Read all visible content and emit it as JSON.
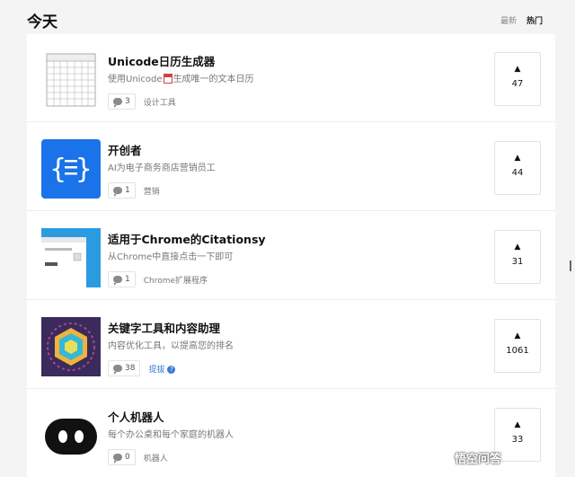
{
  "header": {
    "title": "今天",
    "tabs": [
      {
        "label": "最新",
        "active": false
      },
      {
        "label": "热门",
        "active": true
      }
    ]
  },
  "items": [
    {
      "name": "Unicode日历生成器",
      "desc": "使用Unicode",
      "desc_suffix": "生成唯一的文本日历",
      "comments": "3",
      "tag": "设计工具",
      "votes": "47",
      "thumb_icon": "calendar-grid-icon"
    },
    {
      "name": "开创者",
      "desc": "AI为电子商务商店营销员工",
      "comments": "1",
      "tag": "营销",
      "votes": "44",
      "thumb_icon": "braces-chat-icon",
      "thumb_color": "#1a73e8"
    },
    {
      "name": "适用于Chrome的Citationsy",
      "desc": "从Chrome中直接点击一下即可",
      "comments": "1",
      "tag": "Chrome扩展程序",
      "votes": "31",
      "thumb_icon": "browser-screenshot-icon"
    },
    {
      "name": "关键字工具和内容助理",
      "desc": "内容优化工具，以提高您的排名",
      "comments": "38",
      "tag": "提拔",
      "tag_link": true,
      "votes": "1061",
      "thumb_icon": "hexagon-cube-icon"
    },
    {
      "name": "个人机器人",
      "desc": "每个办公桌和每个家庭的机器人",
      "comments": "0",
      "tag": "机器人",
      "votes": "33",
      "thumb_icon": "robot-face-icon"
    }
  ],
  "vote_arrow": "▲",
  "watermark": "悟空问答"
}
